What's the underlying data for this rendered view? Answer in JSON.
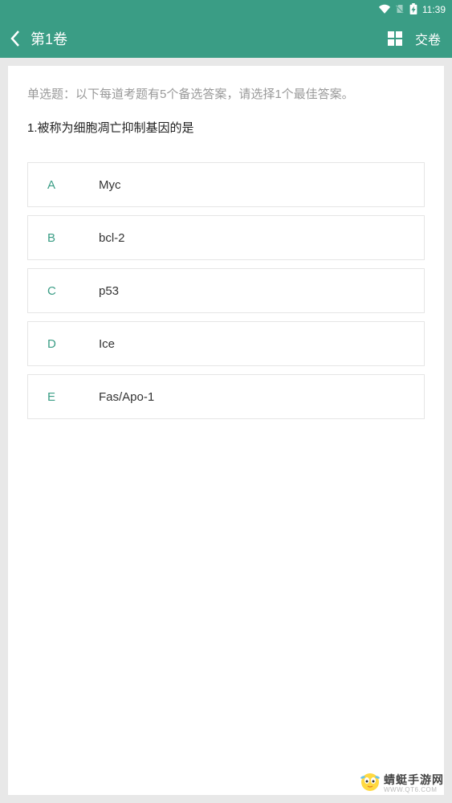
{
  "status_bar": {
    "time": "11:39"
  },
  "header": {
    "title": "第1卷",
    "submit_label": "交卷"
  },
  "quiz": {
    "instruction": "单选题：以下每道考题有5个备选答案，请选择1个最佳答案。",
    "question_number": "1.",
    "question_text": "被称为细胞凋亡抑制基因的是",
    "options": [
      {
        "letter": "A",
        "text": "Myc"
      },
      {
        "letter": "B",
        "text": "bcl-2"
      },
      {
        "letter": "C",
        "text": "p53"
      },
      {
        "letter": "D",
        "text": "Ice"
      },
      {
        "letter": "E",
        "text": "Fas/Apo-1"
      }
    ]
  },
  "watermark": {
    "main": "蜻蜓手游网",
    "sub": "WWW.QT6.COM"
  }
}
